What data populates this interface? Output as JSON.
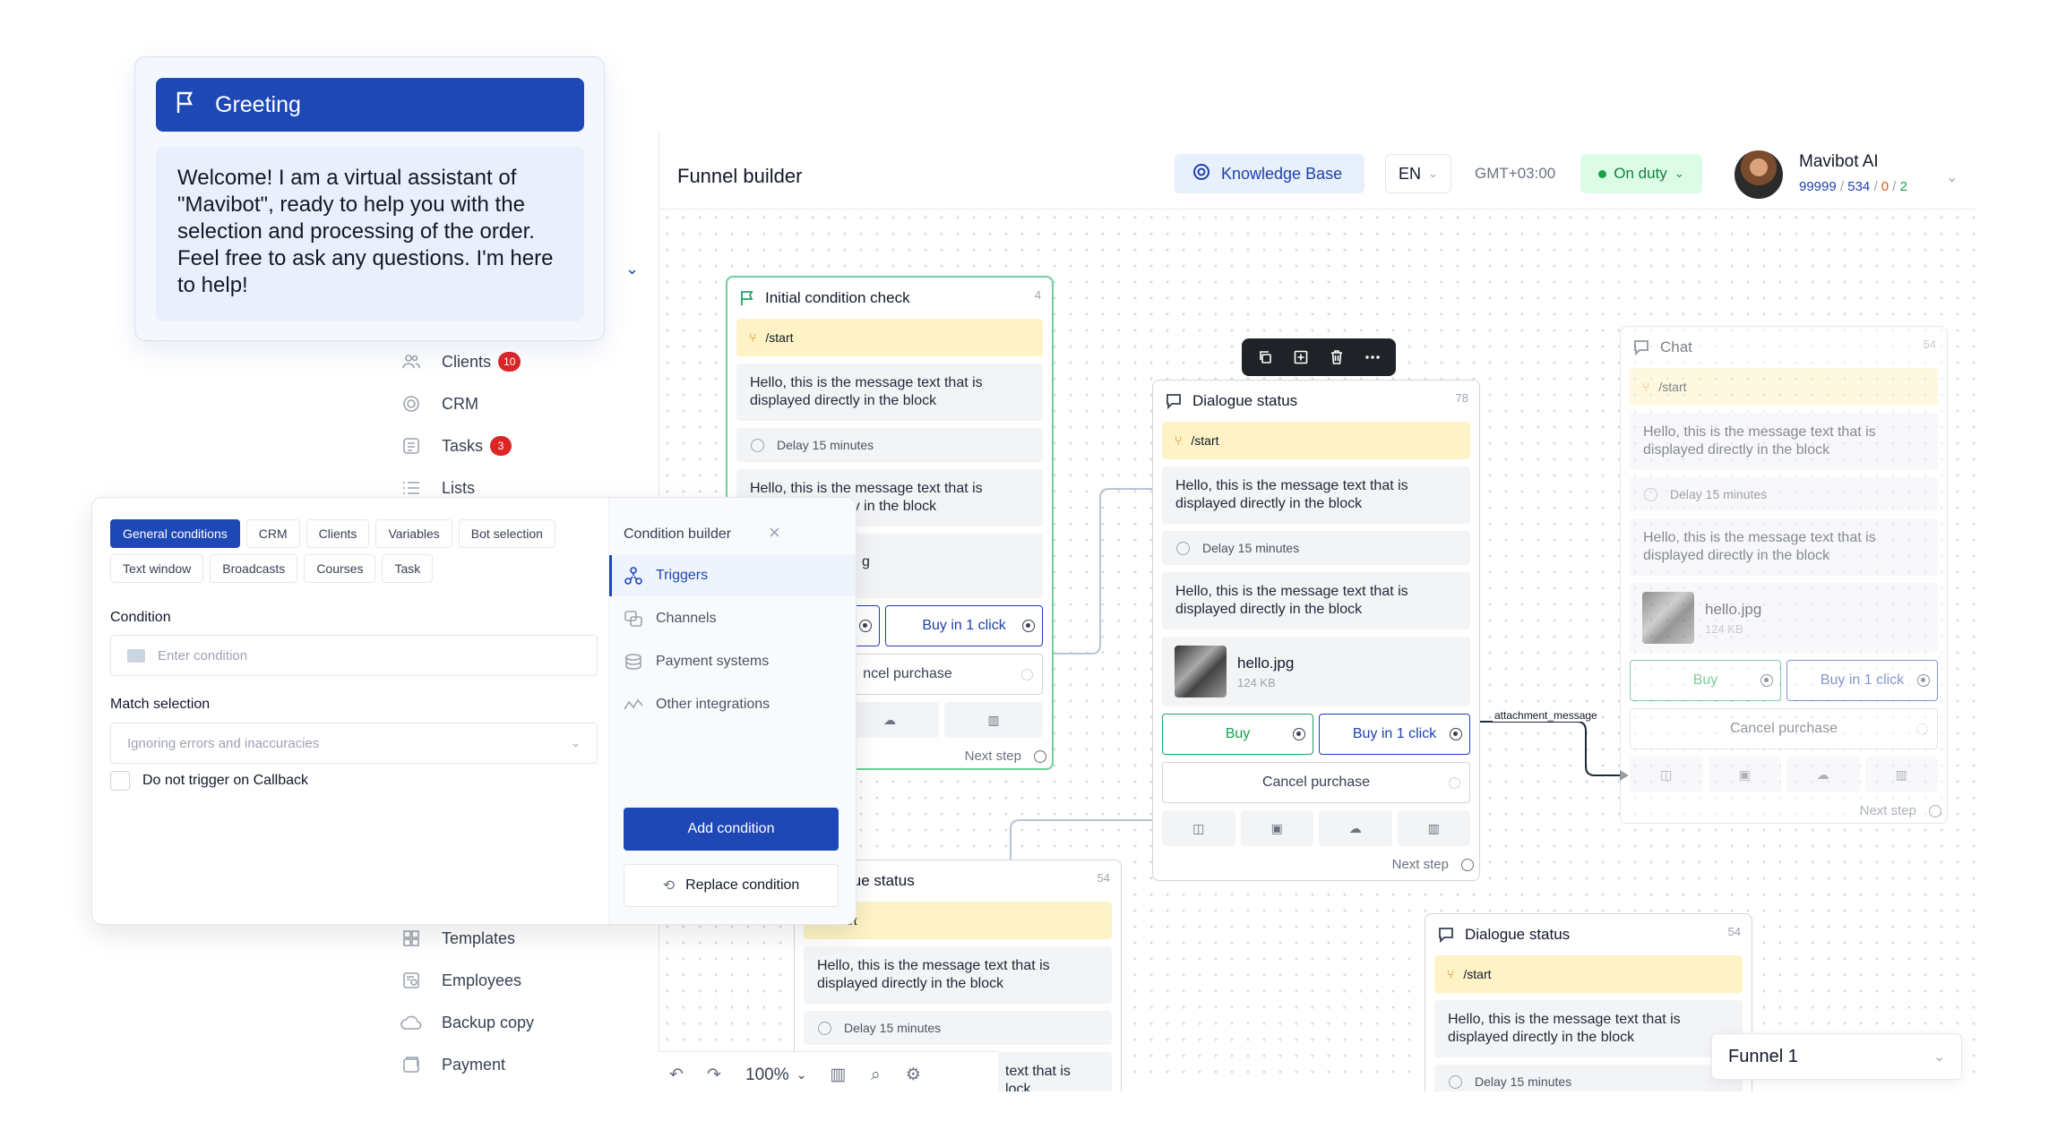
{
  "header": {
    "title": "Funnel builder",
    "knowledge_base": "Knowledge Base",
    "language": "EN",
    "timezone": "GMT+03:00",
    "status": "On duty",
    "user": {
      "name": "Mavibot AI",
      "balance": "99999",
      "count_a": "534",
      "count_b": "0",
      "count_c": "2",
      "sep": "/"
    }
  },
  "sidebar": {
    "items": [
      {
        "label": "Clients",
        "badge": "10",
        "icon": "users-icon"
      },
      {
        "label": "CRM",
        "icon": "target-icon"
      },
      {
        "label": "Tasks",
        "badge": "3",
        "icon": "tasks-icon"
      },
      {
        "label": "Lists",
        "icon": "list-icon"
      },
      {
        "label": "Templates",
        "icon": "templates-icon"
      },
      {
        "label": "Employees",
        "icon": "employees-icon"
      },
      {
        "label": "Backup copy",
        "icon": "cloud-icon"
      },
      {
        "label": "Payment",
        "icon": "payment-icon"
      }
    ]
  },
  "greeting": {
    "title": "Greeting",
    "text": "Welcome! I am a virtual assistant of \"Mavibot\", ready to help you with the selection and processing of the order. Feel free to ask any questions. I'm here to help!"
  },
  "blocks": {
    "b1": {
      "title": "Initial condition check",
      "num": "4",
      "trigger": "/start",
      "msg1": "Hello, this is the message text that is displayed directly in the block",
      "delay": "Delay 15 minutes",
      "msg2": "Hello, this is the message text that is displayed directly in the block",
      "partial": "g",
      "buy1": "Buy in 1 click",
      "cancel": "ncel purchase",
      "next": "Next step"
    },
    "b2": {
      "title": "Dialogue status",
      "num": "78",
      "trigger": "/start",
      "msg1": "Hello, this is the message text that is displayed directly in the block",
      "delay": "Delay 15 minutes",
      "msg2": "Hello, this is the message text that is displayed directly in the block",
      "file": "hello.jpg",
      "size": "124 KB",
      "buy": "Buy",
      "buy1": "Buy in 1 click",
      "cancel": "Cancel purchase",
      "next": "Next step"
    },
    "b3": {
      "title": "Chat",
      "num": "54",
      "trigger": "/start",
      "msg1": "Hello, this is the message text that is displayed directly in the block",
      "delay": "Delay 15 minutes",
      "msg2": "Hello, this is the message text that is displayed directly in the block",
      "file": "hello.jpg",
      "size": "124 KB",
      "buy": "Buy",
      "buy1": "Buy in 1 click",
      "cancel": "Cancel purchase",
      "next": "Next step"
    },
    "b4": {
      "title": "logue status",
      "num": "54",
      "trigger": "start",
      "msg1": "Hello, this is the message text that is displayed directly in the block",
      "delay": "Delay 15 minutes",
      "msg2": "text that is",
      "msg3": "lock"
    },
    "b5": {
      "title": "Dialogue status",
      "num": "54",
      "trigger": "/start",
      "msg1": "Hello, this is the message text that is displayed directly in the block",
      "delay": "Delay 15 minutes"
    }
  },
  "connector_label": "attachment_message",
  "zoom": "100%",
  "funnel_select": "Funnel 1",
  "condition_panel": {
    "tabs": [
      "General conditions",
      "CRM",
      "Clients",
      "Variables",
      "Bot selection",
      "Text window",
      "Broadcasts",
      "Courses",
      "Task"
    ],
    "active_tab": "General conditions",
    "condition_label": "Condition",
    "condition_placeholder": "Enter condition",
    "match_label": "Match selection",
    "match_value": "Ignoring errors and inaccuracies",
    "checkbox_label": "Do not trigger on Callback",
    "builder_title": "Condition builder",
    "builder_items": [
      "Triggers",
      "Channels",
      "Payment systems",
      "Other integrations"
    ],
    "active_item": "Triggers",
    "add_button": "Add condition",
    "replace_button": "Replace condition"
  },
  "colors": {
    "primary": "#1e48b5",
    "trigger_bg": "#fdf3c6",
    "selected_border": "#6fcf97",
    "duty_bg": "#dcfce7"
  }
}
